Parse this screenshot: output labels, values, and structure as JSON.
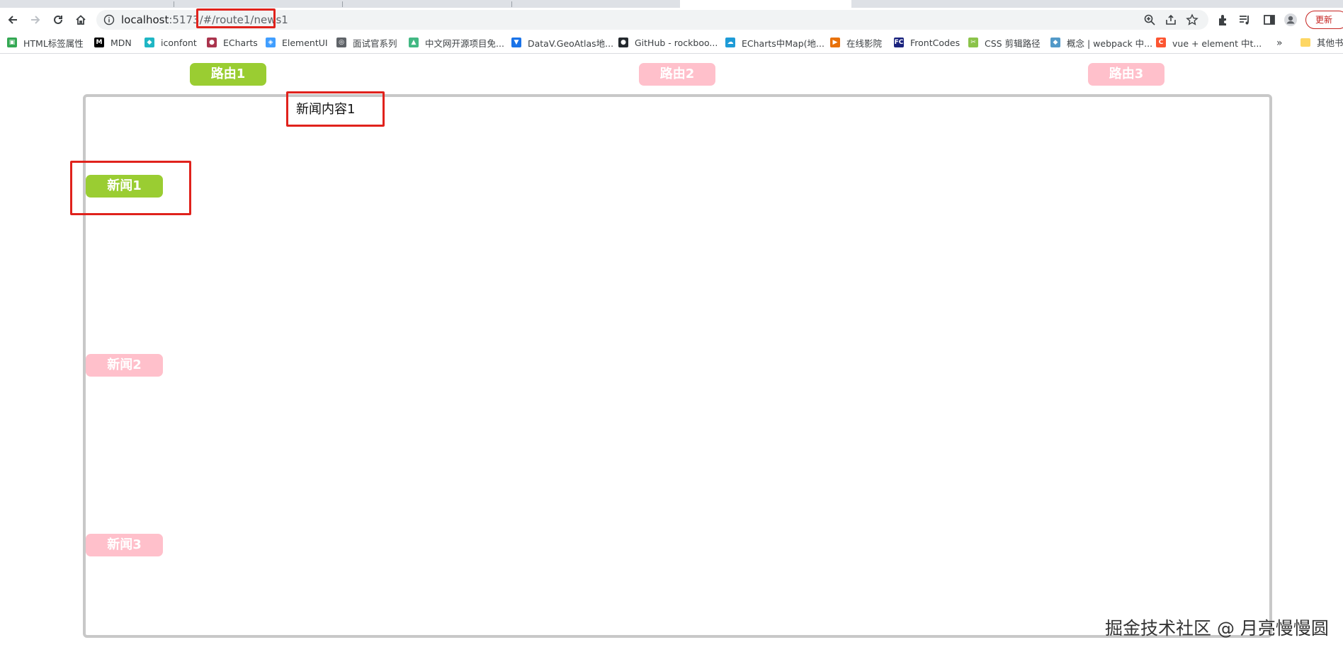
{
  "browser": {
    "url_host": "localhost",
    "url_rest": ":5173/#/route1/news1",
    "update_label": "更新",
    "colors": {
      "highlight": "#e0221c"
    }
  },
  "bookmarks": [
    {
      "label": "HTML标签属性",
      "icon": "html-bookmark-icon",
      "color": "#34a853"
    },
    {
      "label": "MDN",
      "icon": "mdn-bookmark-icon",
      "color": "#000000"
    },
    {
      "label": "iconfont",
      "icon": "iconfont-bookmark-icon",
      "color": "#1fb6c4"
    },
    {
      "label": "ECharts",
      "icon": "echarts-bookmark-icon",
      "color": "#aa344d"
    },
    {
      "label": "ElementUI",
      "icon": "element-bookmark-icon",
      "color": "#409eff"
    },
    {
      "label": "面试官系列",
      "icon": "globe-bookmark-icon",
      "color": "#5f6368"
    },
    {
      "label": "中文网开源项目免...",
      "icon": "vue-bookmark-icon",
      "color": "#42b883"
    },
    {
      "label": "DataV.GeoAtlas地...",
      "icon": "datav-bookmark-icon",
      "color": "#1a73e8"
    },
    {
      "label": "GitHub - rockboo...",
      "icon": "github-bookmark-icon",
      "color": "#24292e"
    },
    {
      "label": "ECharts中Map(地...",
      "icon": "cloud-bookmark-icon",
      "color": "#1e9bd7"
    },
    {
      "label": "在线影院",
      "icon": "play-bookmark-icon",
      "color": "#e8710a"
    },
    {
      "label": "FrontCodes",
      "icon": "fc-bookmark-icon",
      "color": "#1a237e"
    },
    {
      "label": "CSS 剪辑路径",
      "icon": "css-bookmark-icon",
      "color": "#8bc34a"
    },
    {
      "label": "概念 | webpack 中...",
      "icon": "webpack-bookmark-icon",
      "color": "#5299c8"
    },
    {
      "label": "vue + element 中t...",
      "icon": "csdn-bookmark-icon",
      "color": "#fc5531"
    }
  ],
  "bookmarks_more": "»",
  "bookmarks_folder": "其他书",
  "routes": [
    {
      "label": "路由1",
      "active": true
    },
    {
      "label": "路由2",
      "active": false
    },
    {
      "label": "路由3",
      "active": false
    }
  ],
  "news": [
    {
      "label": "新闻1",
      "active": true
    },
    {
      "label": "新闻2",
      "active": false
    },
    {
      "label": "新闻3",
      "active": false
    }
  ],
  "news_content": "新闻内容1",
  "watermark": "掘金技术社区 @ 月亮慢慢圆",
  "colors": {
    "active": "#9acd32",
    "inactive": "#ffc0cb",
    "box_border": "#c8c8c8"
  }
}
